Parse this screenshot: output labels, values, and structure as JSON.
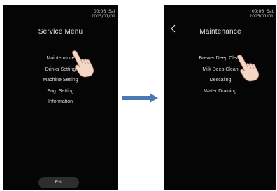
{
  "colors": {
    "screen_bg": "#050505",
    "text": "#dcdcdc",
    "exit_button_bg": "#2e2e2e",
    "arrow": "#4a78b5",
    "hand_fill": "#f3d6c4",
    "hand_outline": "#a77d68"
  },
  "left_screen": {
    "clock": {
      "time": "00:06",
      "day": "Sat",
      "date": "2005/01/01"
    },
    "title": "Service Menu",
    "menu_items": [
      {
        "label": "Maintenance"
      },
      {
        "label": "Drinks Setting"
      },
      {
        "label": "Machine Setting"
      },
      {
        "label": "Eng. Setting"
      },
      {
        "label": "Information"
      }
    ],
    "exit_label": "Exit",
    "pointer_icon": "hand-pointer-icon"
  },
  "transition_arrow_icon": "right-arrow-icon",
  "right_screen": {
    "clock": {
      "time": "00:06",
      "day": "Sat",
      "date": "2005/01/01"
    },
    "back_icon": "chevron-left-icon",
    "title": "Maintenance",
    "menu_items": [
      {
        "label": "Brewer Deep Clean"
      },
      {
        "label": "Milk Deep Clean"
      },
      {
        "label": "Descaling"
      },
      {
        "label": "Water Draining"
      }
    ],
    "pointer_icon": "hand-pointer-icon"
  }
}
